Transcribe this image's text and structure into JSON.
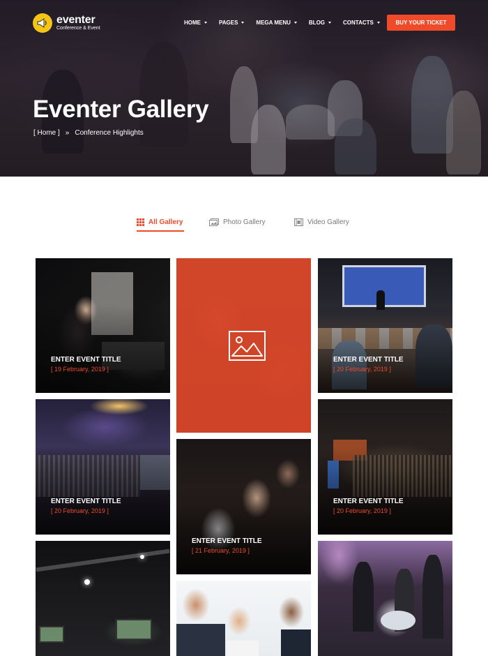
{
  "header": {
    "logo": {
      "brand": "eventer",
      "tagline": "Conference & Event"
    },
    "nav": [
      {
        "label": "HOME"
      },
      {
        "label": "PAGES"
      },
      {
        "label": "MEGA MENU"
      },
      {
        "label": "BLOG"
      },
      {
        "label": "CONTACTS"
      }
    ],
    "cta": "BUY YOUR TICKET"
  },
  "hero": {
    "title": "Eventer Gallery",
    "breadcrumb": [
      "[ Home ]",
      "»",
      "Conference Highlights"
    ]
  },
  "tabs": [
    {
      "label": "All Gallery",
      "icon": "grid-icon",
      "active": true
    },
    {
      "label": "Photo Gallery",
      "icon": "photo-icon",
      "active": false
    },
    {
      "label": "Video Gallery",
      "icon": "film-icon",
      "active": false
    }
  ],
  "gallery": [
    {
      "title": "ENTER EVENT TITLE",
      "date": "[ 19 February, 2019 ]"
    },
    {
      "title": "",
      "date": ""
    },
    {
      "title": "ENTER EVENT TITLE",
      "date": "[ 20 February, 2019 ]"
    },
    {
      "title": "ENTER EVENT TITLE",
      "date": "[ 20 February, 2019 ]"
    },
    {
      "title": "ENTER EVENT TITLE",
      "date": "[ 21 February, 2019 ]"
    },
    {
      "title": "ENTER EVENT TITLE",
      "date": "[ 20 February, 2019 ]"
    },
    {
      "title": "",
      "date": ""
    },
    {
      "title": "",
      "date": ""
    },
    {
      "title": "",
      "date": ""
    }
  ],
  "colors": {
    "accent": "#ef4a2a",
    "logo": "#f4c417"
  }
}
